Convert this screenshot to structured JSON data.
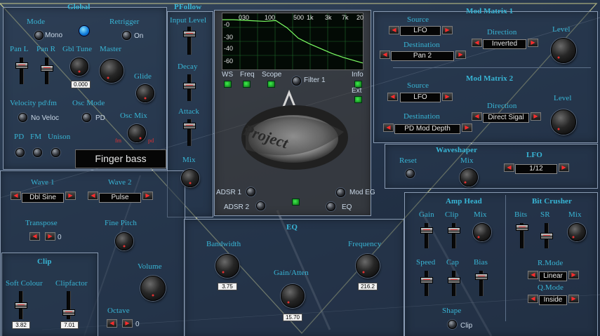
{
  "global": {
    "title": "Global",
    "mode_label": "Mode",
    "mode_value": "Mono",
    "retrigger_label": "Retrigger",
    "retrigger_value": "On",
    "pan_l": "Pan L",
    "pan_r": "Pan R",
    "gbl_tune": "Gbl Tune",
    "master": "Master",
    "gbl_tune_value": "0.000",
    "glide": "Glide",
    "velocity_label": "Velocity pd\\fm",
    "velocity_value": "No Veloc",
    "osc_mode_label": "Osc Mode",
    "osc_mode_value": "PD",
    "osc_mix": "Osc Mix",
    "fm_mark": "fm",
    "pd_mark": "pd",
    "pd": "PD",
    "fm": "FM",
    "unison": "Unison"
  },
  "preset_name": "Finger bass",
  "pfollow": {
    "title": "PFollow",
    "input_level": "Input Level",
    "decay": "Decay",
    "attack": "Attack",
    "mix": "Mix"
  },
  "scope": {
    "ticks_x": [
      "0",
      "30",
      "100",
      "500",
      "1k",
      "3k",
      "7k",
      "20"
    ],
    "ticks_y": [
      "-0",
      "-30",
      "-40",
      "-60"
    ],
    "ws": "WS",
    "freq": "Freq",
    "scope": "Scope",
    "filter1": "Filter 1",
    "info": "Info",
    "ext": "Ext",
    "adsr1": "ADSR 1",
    "adsr2": "ADSR 2",
    "mod_eg": "Mod EG",
    "eq": "EQ",
    "logo": "Project"
  },
  "mod_matrix_1": {
    "title": "Mod Matrix 1",
    "source_label": "Source",
    "source_value": "LFO",
    "destination_label": "Destination",
    "destination_value": "Pan 2",
    "direction_label": "Direction",
    "direction_value": "Inverted",
    "level": "Level"
  },
  "mod_matrix_2": {
    "title": "Mod Matrix 2",
    "source_label": "Source",
    "source_value": "LFO",
    "destination_label": "Destination",
    "destination_value": "PD Mod Depth",
    "direction_label": "Direction",
    "direction_value": "Direct Sigal",
    "level": "Level"
  },
  "waveshaper": {
    "title": "Waveshaper",
    "reset": "Reset",
    "mix": "Mix"
  },
  "lfo": {
    "title": "LFO",
    "rate_value": "1/12"
  },
  "osc": {
    "wave1_label": "Wave 1",
    "wave1_value": "Dbl Sine",
    "wave2_label": "Wave 2",
    "wave2_value": "Pulse",
    "transpose": "Transpose",
    "transpose_value": "0",
    "fine_pitch": "Fine Pitch",
    "volume": "Volume",
    "octave": "Octave",
    "octave_value": "0"
  },
  "clip": {
    "title": "Clip",
    "soft_colour": "Soft Colour",
    "clipfactor": "Clipfactor",
    "soft_value": "3.82",
    "factor_value": "7.01"
  },
  "eq": {
    "title": "EQ",
    "bandwidth": "Bandwidth",
    "bandwidth_value": "3.75",
    "gain": "Gain/Atten",
    "gain_value": "15.70",
    "frequency": "Frequency",
    "frequency_value": "216.2"
  },
  "amp_head": {
    "title": "Amp Head",
    "gain": "Gain",
    "clip": "Clip",
    "mix": "Mix",
    "speed": "Speed",
    "cap": "Cap",
    "bias": "Bias",
    "shape": "Shape",
    "shape_value": "Clip"
  },
  "bit_crusher": {
    "title": "Bit Crusher",
    "bits": "Bits",
    "sr": "SR",
    "mix": "Mix",
    "r_mode": "R.Mode",
    "r_mode_value": "Linear",
    "q_mode": "Q.Mode",
    "q_mode_value": "Inside"
  },
  "colors": {
    "label": "#38b6d6",
    "accent_red": "#e33232",
    "led_green": "#3df04c",
    "panel_border": "#8a9cb4"
  },
  "spectrum": {
    "curve": [
      [
        0,
        -8
      ],
      [
        0.08,
        -8
      ],
      [
        0.18,
        -9
      ],
      [
        0.3,
        -10
      ],
      [
        0.38,
        -9
      ],
      [
        0.46,
        -18
      ],
      [
        0.54,
        -31
      ],
      [
        0.62,
        -38
      ],
      [
        0.7,
        -44
      ],
      [
        0.78,
        -50
      ],
      [
        0.86,
        -55
      ],
      [
        0.94,
        -59
      ],
      [
        1,
        -62
      ]
    ]
  }
}
